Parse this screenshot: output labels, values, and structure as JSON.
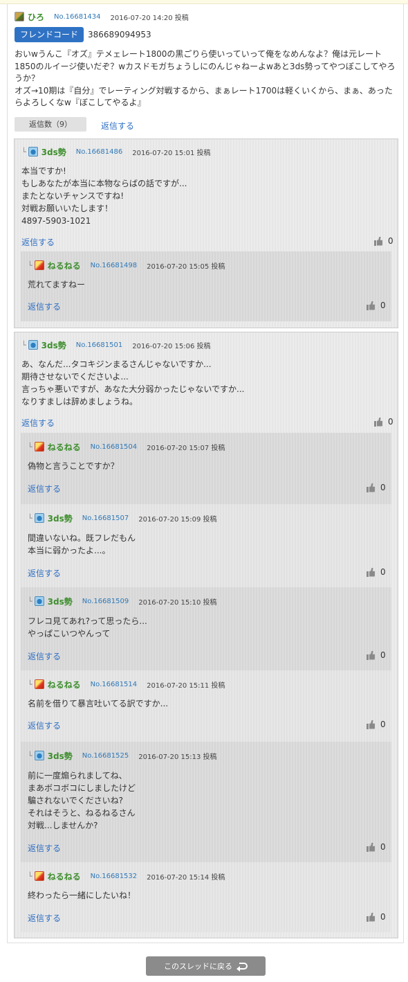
{
  "main_post": {
    "username": "ひろ",
    "number": "No.16681434",
    "datetime": "2016-07-20 14:20 投稿",
    "friend_code_label": "フレンドコード",
    "friend_code": "386689094953",
    "body": [
      "おいwうんこ『オズ』テメェレート1800の黒ごりら使いっていって俺をなめんなよ？俺は元レート",
      "1850のルイージ使いだぞ？wカスドモガちょうしにのんじゃねーよwあと3ds勢ってやつぼこしてやろ",
      "うか？",
      "オズ→10期は『自分』でレーティング対戦するから、まぁレート1700は軽くいくから、まぁ、あった",
      "らよろしくなw『ぼこしてやるよ』"
    ],
    "reply_count": "返信数（9）",
    "reply_label": "返信する"
  },
  "threads": [
    {
      "username": "3ds勢",
      "number": "No.16681486",
      "datetime": "2016-07-20 15:01 投稿",
      "body": [
        "本当ですか!",
        "もしあなたが本当に本物ならばの話ですが...",
        "またとないチャンスですね!",
        "対戦お願いいたします！",
        "4897-5903-1021"
      ],
      "reply_label": "返信する",
      "likes": "0",
      "replies": [
        {
          "username": "ねるねる",
          "number": "No.16681498",
          "datetime": "2016-07-20 15:05 投稿",
          "body": [
            "荒れてますねー"
          ],
          "reply_label": "返信する",
          "likes": "0"
        }
      ]
    },
    {
      "username": "3ds勢",
      "number": "No.16681501",
      "datetime": "2016-07-20 15:06 投稿",
      "body": [
        "あ、なんだ...タコキジンまるさんじゃないですか...",
        "期待させないでくださいよ...",
        "言っちゃ悪いですが、あなた大分弱かったじゃないですか...",
        "なりすましは辞めましょうね。"
      ],
      "reply_label": "返信する",
      "likes": "0",
      "replies": [
        {
          "username": "ねるねる",
          "number": "No.16681504",
          "datetime": "2016-07-20 15:07 投稿",
          "body": [
            "偽物と言うことですか？"
          ],
          "reply_label": "返信する",
          "likes": "0"
        },
        {
          "username": "3ds勢",
          "number": "No.16681507",
          "datetime": "2016-07-20 15:09 投稿",
          "body": [
            "間違いないね。既フレだもん",
            "本当に弱かったよ...。"
          ],
          "reply_label": "返信する",
          "likes": "0"
        },
        {
          "username": "3ds勢",
          "number": "No.16681509",
          "datetime": "2016-07-20 15:10 投稿",
          "body": [
            "フレコ見てあれ?って思ったら...",
            "やっぱこいつやんって"
          ],
          "reply_label": "返信する",
          "likes": "0"
        },
        {
          "username": "ねるねる",
          "number": "No.16681514",
          "datetime": "2016-07-20 15:11 投稿",
          "body": [
            "名前を借りて暴言吐いてる訳ですか..."
          ],
          "reply_label": "返信する",
          "likes": "0"
        },
        {
          "username": "3ds勢",
          "number": "No.16681525",
          "datetime": "2016-07-20 15:13 投稿",
          "body": [
            "前に一度煽られましてね、",
            "まあボコボコにしましたけど",
            "騙されないでくださいね?",
            "それはそうと、ねるねるさん",
            "対戦...しませんか?"
          ],
          "reply_label": "返信する",
          "likes": "0"
        },
        {
          "username": "ねるねる",
          "number": "No.16681532",
          "datetime": "2016-07-20 15:14 投稿",
          "body": [
            "終わったら一緒にしたいね！"
          ],
          "reply_label": "返信する",
          "likes": "0"
        }
      ]
    }
  ],
  "back_button_label": "このスレッドに戻る",
  "colors": {
    "username": "#3e8e2e",
    "post_number": "#2e78b8",
    "link": "#2e6fc4",
    "friend_code_badge": "#2f72c4",
    "back_button": "#8b8b8b"
  }
}
